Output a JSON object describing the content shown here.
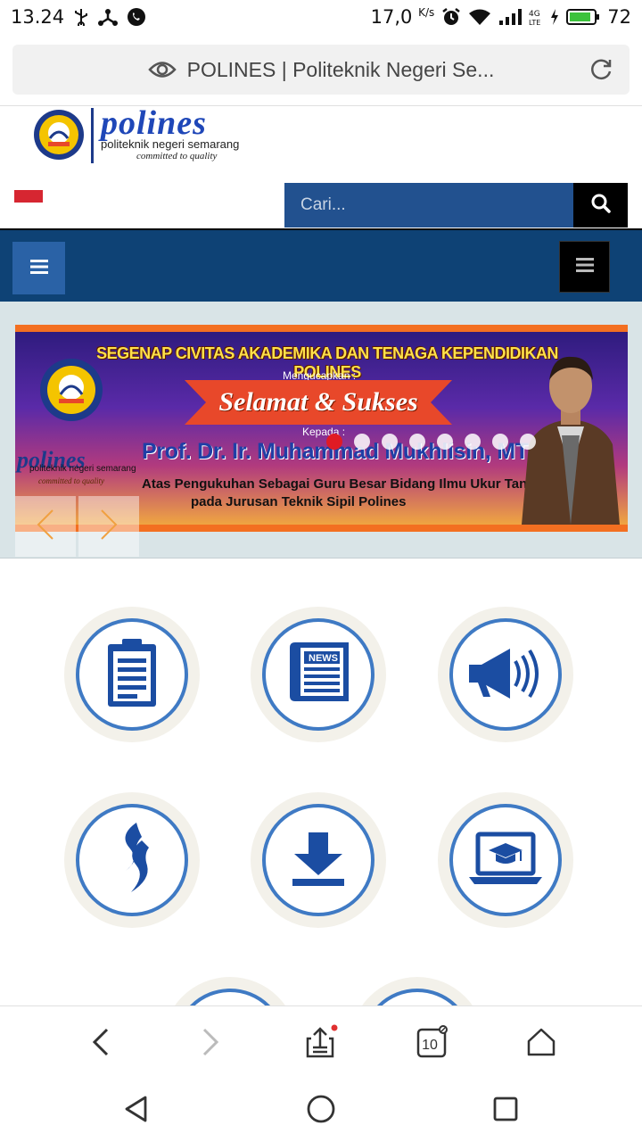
{
  "status_bar": {
    "time": "13.24",
    "net_speed": "17,0",
    "net_unit": "K/s",
    "battery": "72"
  },
  "address_bar": {
    "title": "POLINES | Politeknik Negeri Se..."
  },
  "header": {
    "brand": "polines",
    "tagline": "politeknik negeri semarang",
    "motto": "committed to quality",
    "search_placeholder": "Cari..."
  },
  "banner": {
    "headline": "SEGENAP CIVITAS AKADEMIKA DAN TENAGA KEPENDIDIKAN POLINES",
    "mengucapkan": "Mengucapkan :",
    "greeting": "Selamat & Sukses",
    "kepada": "Kepada :",
    "name": "Prof. Dr. Ir. Muhammad Mukhlisin, MT",
    "line1": "Atas Pengukuhan Sebagai Guru Besar Bidang Ilmu Ukur Tanah",
    "line2": "pada Jurusan Teknik Sipil Polines",
    "logo_brand": "polines",
    "logo_tagline": "politeknik negeri semarang",
    "logo_motto": "committed to quality",
    "seal_text_top": "politeknik negeri",
    "seal_text_bottom": "SEMARANG",
    "slide_count": 8,
    "active_slide": 0
  },
  "tiles": [
    {
      "name": "announcement-board-icon"
    },
    {
      "name": "news-icon"
    },
    {
      "name": "megaphone-icon"
    },
    {
      "name": "flame-logo-icon"
    },
    {
      "name": "download-icon"
    },
    {
      "name": "elearning-laptop-icon"
    }
  ],
  "toolbar": {
    "tabs_count": "10"
  },
  "colors": {
    "navy": "#0e4275",
    "search_blue": "#22518f",
    "ring_blue": "#3f7ac4",
    "tile_bg": "#f3f1ea",
    "flag_red": "#d62631"
  }
}
